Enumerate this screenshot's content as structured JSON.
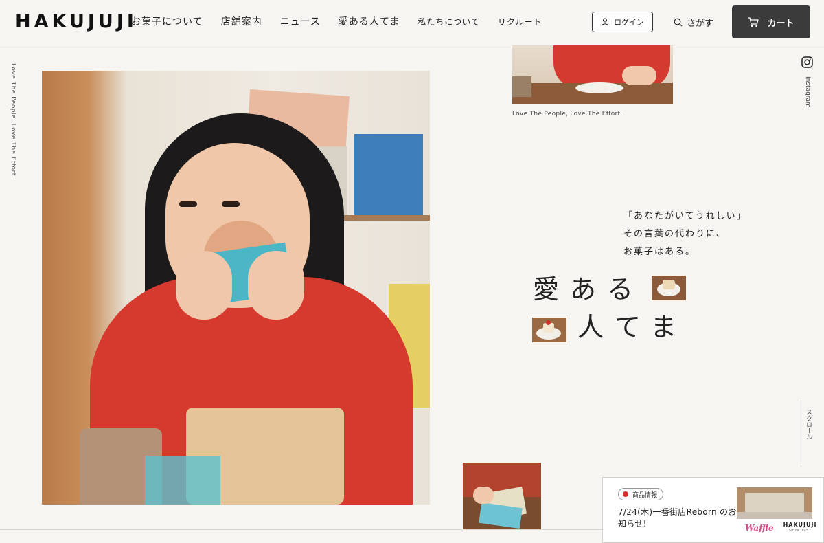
{
  "brand": {
    "logo": "HAKUJUJI"
  },
  "nav": {
    "items": [
      {
        "label": "お菓子について"
      },
      {
        "label": "店舗案内"
      },
      {
        "label": "ニュース"
      },
      {
        "label": "愛ある人てま"
      },
      {
        "label": "私たちについて"
      },
      {
        "label": "リクルート"
      }
    ]
  },
  "header": {
    "login_label": "ログイン",
    "search_label": "さがす",
    "cart_label": "カート"
  },
  "side": {
    "left_text": "Love The People, Love The Effort.",
    "instagram_label": "Instagram",
    "scroll_label": "スクロール"
  },
  "hero": {
    "caption": "Love The People, Love The Effort.",
    "lead_lines": [
      "「あなたがいてうれしい」",
      "その言葉の代わりに、",
      "お菓子はある。"
    ],
    "title_line1": "愛ある",
    "title_line2": "人てま"
  },
  "news": {
    "badge": "商品情報",
    "title": "7/24(木)一番街店Reborn のお知らせ!",
    "logo_waffle": "Waffle",
    "logo_hakujuji": "HAKUJUJI",
    "logo_since": "Since 1957"
  },
  "colors": {
    "background": "#f7f5f2",
    "cart_button": "#3b3b3b",
    "accent_red": "#d3302a"
  }
}
